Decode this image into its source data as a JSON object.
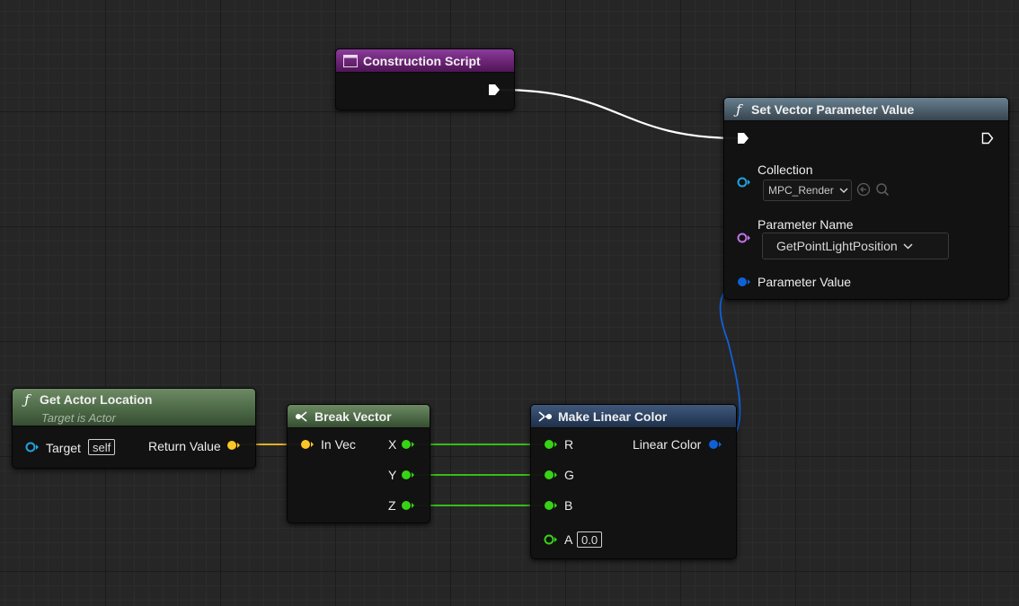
{
  "nodes": {
    "construction_script": {
      "title": "Construction Script"
    },
    "set_vector_param": {
      "title": "Set Vector Parameter Value",
      "collection_label": "Collection",
      "collection_value": "MPC_Render",
      "param_name_label": "Parameter Name",
      "param_name_value": "GetPointLightPosition",
      "param_value_label": "Parameter Value"
    },
    "get_actor_location": {
      "title": "Get Actor Location",
      "subtitle": "Target is Actor",
      "target_label": "Target",
      "target_value": "self",
      "return_label": "Return Value"
    },
    "break_vector": {
      "title": "Break Vector",
      "in_label": "In Vec",
      "x_label": "X",
      "y_label": "Y",
      "z_label": "Z"
    },
    "make_linear_color": {
      "title": "Make Linear Color",
      "r_label": "R",
      "g_label": "G",
      "b_label": "B",
      "a_label": "A",
      "a_value": "0.0",
      "out_label": "Linear Color"
    }
  },
  "colors": {
    "exec_wire": "#ffffff",
    "vector_pin": "#fdc627",
    "float_pin": "#38d216",
    "struct_pin": "#1060d8",
    "object_pin": "#1fa4e0",
    "name_pin": "#c071e6",
    "header_event": "#6b2474",
    "header_function": "#4c5f6c",
    "header_pure": "#4d6a47"
  },
  "icons": [
    "event-graph-icon",
    "function-icon",
    "break-struct-icon",
    "make-struct-icon",
    "exec-pin-icon",
    "browse-arrow-icon",
    "search-icon",
    "chevron-down-icon"
  ]
}
